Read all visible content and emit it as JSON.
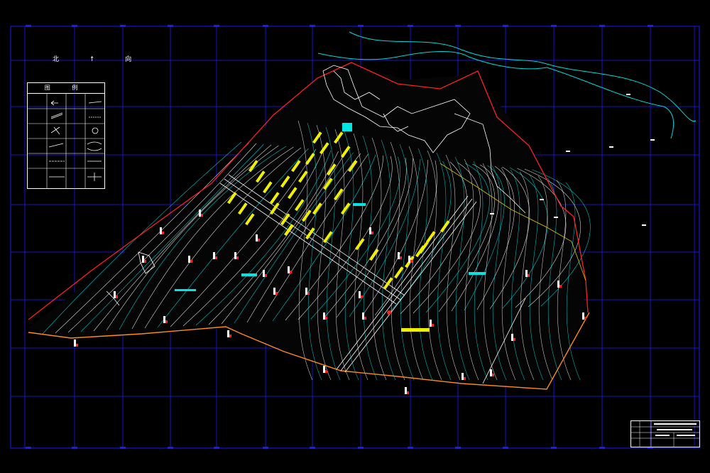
{
  "drawing": {
    "background": "#000000",
    "grid_color": "#1a1aff",
    "boundary_color": "#ff2020",
    "contour_colors": [
      "#ffffff",
      "#00e5e5"
    ],
    "road_fill": "#f0f000",
    "water_color": "#00d8d8"
  },
  "north_label": "北 ↑ 向",
  "legend": {
    "title": "图 例",
    "cells": [
      "",
      "",
      "",
      "",
      "",
      "",
      "",
      "",
      "",
      "",
      "",
      "",
      "",
      "",
      "",
      "",
      "",
      "",
      "",
      "",
      "",
      "",
      "",
      ""
    ]
  },
  "title_block": {
    "lines": [
      "",
      "",
      "",
      ""
    ]
  }
}
